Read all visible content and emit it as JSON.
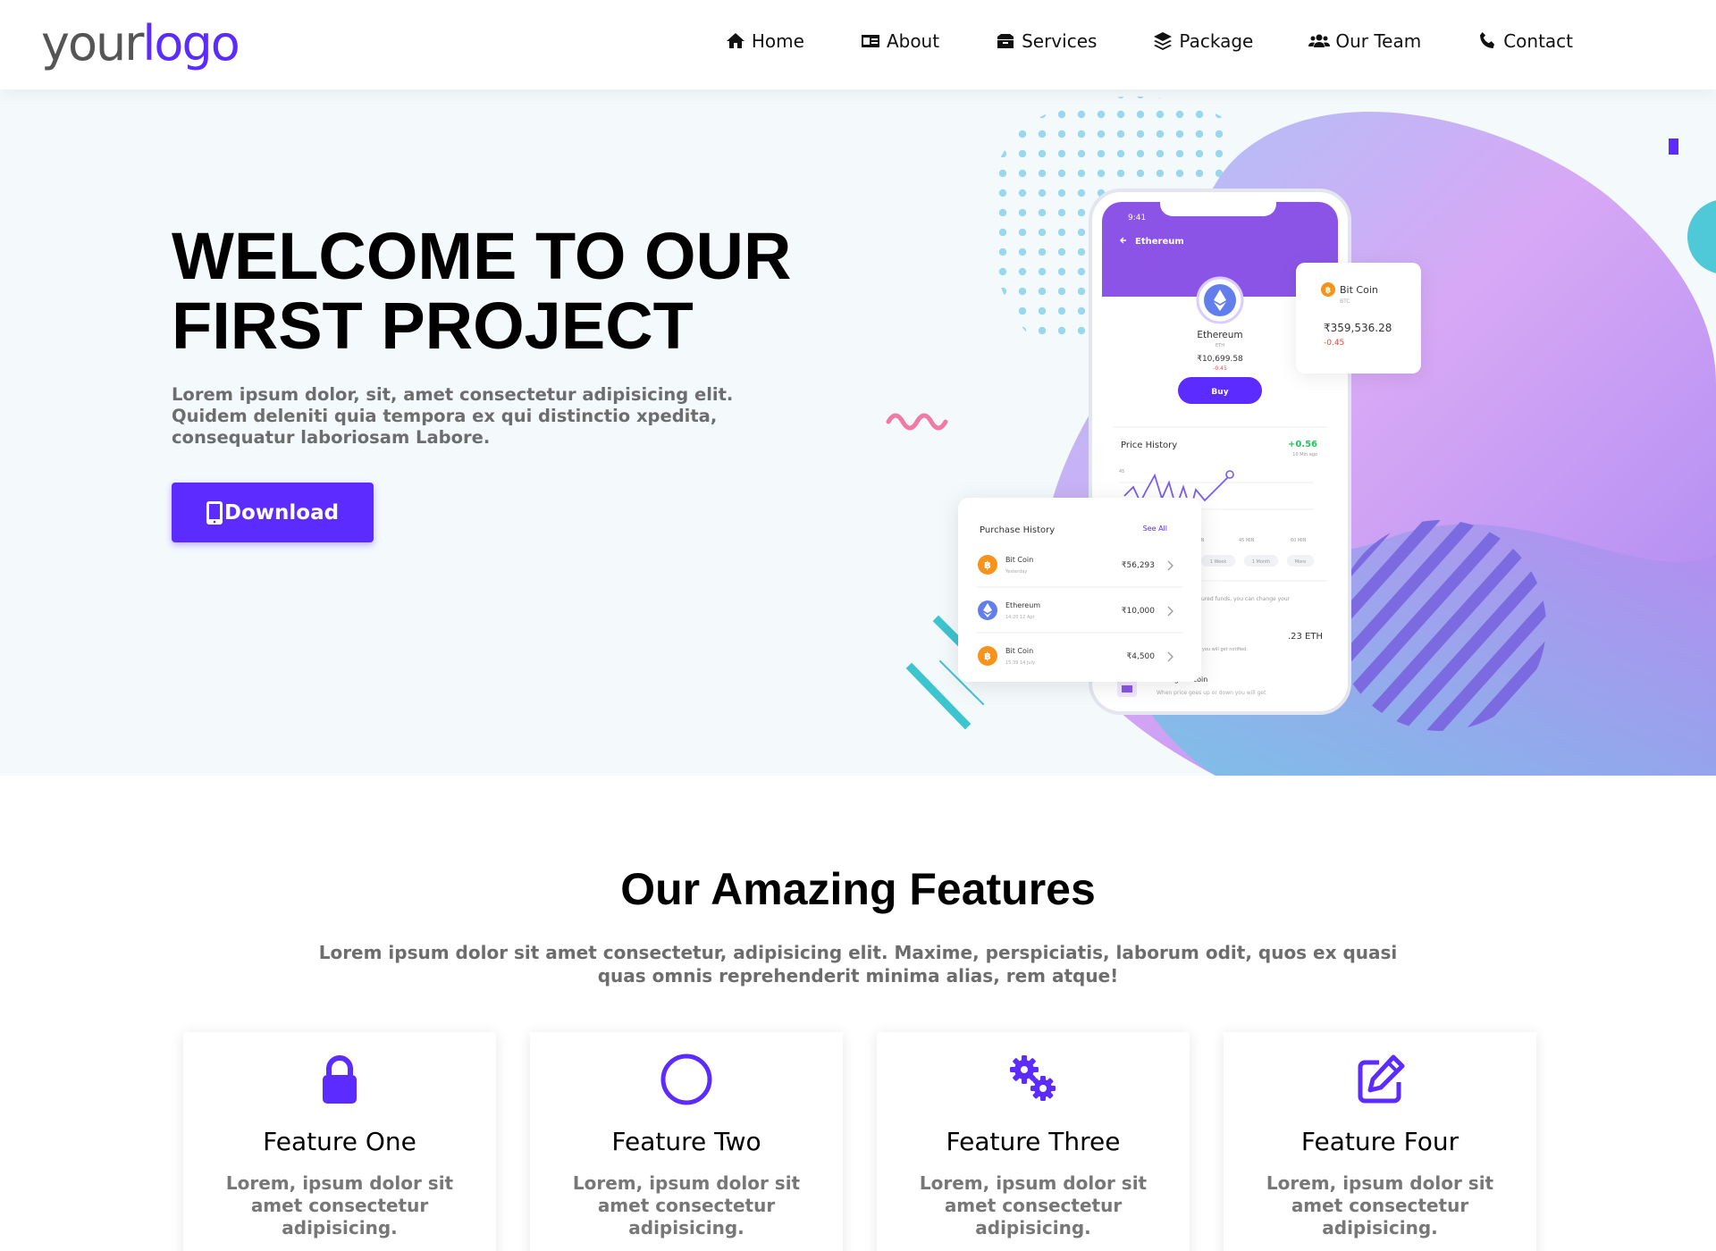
{
  "logo": {
    "word1": "your",
    "word2": "logo"
  },
  "nav": {
    "home": "Home",
    "about": "About",
    "services": "Services",
    "package": "Package",
    "team": "Our Team",
    "contact": "Contact"
  },
  "hero": {
    "title_line1": "WELCOME TO OUR",
    "title_line2": "FIRST PROJECT",
    "text": "Lorem ipsum dolor, sit, amet consectetur adipisicing elit. Quidem deleniti quia tempora ex qui distinctio xpedita, consequatur laboriosam Labore.",
    "download_label": "Download"
  },
  "phone": {
    "time": "9:41",
    "back_title": "Ethereum",
    "coin_name": "Ethereum",
    "coin_code": "ETH",
    "price": "₹10,699.58",
    "change": "-0.45",
    "buy": "Buy",
    "price_history": "Price History",
    "history_change": "+0.56",
    "history_sub": "10 Min ago",
    "axis_45": "45",
    "tick_1": "MIN",
    "tick_2": "45 MIN",
    "tick_3": "60 MIN",
    "filter_1": "1 Week",
    "filter_2": "1 Month",
    "filter_3": "More",
    "secure_text": "ecured funds, you can change your",
    "eth_amount": ".23 ETH",
    "notify_text": "en you will get notified.",
    "alert_title": "Selling Bit coin",
    "alert_sub": "When price goes up or down you will get"
  },
  "btc_card": {
    "name": "Bit Coin",
    "code": "BTC",
    "price": "₹359,536.28",
    "change": "-0.45"
  },
  "purchase": {
    "title": "Purchase History",
    "see_all": "See All",
    "items": [
      {
        "name": "Bit Coin",
        "date": "Yesterday",
        "amount": "₹56,293"
      },
      {
        "name": "Ethereum",
        "date": "14:20 12 Apr",
        "amount": "₹10,000"
      },
      {
        "name": "Bit Coin",
        "date": "15:39 14 July",
        "amount": "₹4,500"
      }
    ]
  },
  "features": {
    "title": "Our Amazing Features",
    "subtitle": "Lorem ipsum dolor sit amet consectetur, adipisicing elit. Maxime, perspiciatis, laborum odit, quos ex quasi quas omnis reprehenderit minima alias, rem atque!",
    "cards": [
      {
        "title": "Feature One",
        "text": "Lorem, ipsum dolor sit amet consectetur adipisicing.",
        "icon": "lock-icon"
      },
      {
        "title": "Feature Two",
        "text": "Lorem, ipsum dolor sit amet consectetur adipisicing.",
        "icon": "circle-icon"
      },
      {
        "title": "Feature Three",
        "text": "Lorem, ipsum dolor sit amet consectetur adipisicing.",
        "icon": "gears-icon"
      },
      {
        "title": "Feature Four",
        "text": "Lorem, ipsum dolor sit amet consectetur adipisicing.",
        "icon": "edit-icon"
      }
    ]
  },
  "colors": {
    "accent": "#5b2bff",
    "bitcoin": "#f7931a",
    "ethereum": "#627eea",
    "positive": "#22c55e",
    "negative": "#ef4444"
  }
}
